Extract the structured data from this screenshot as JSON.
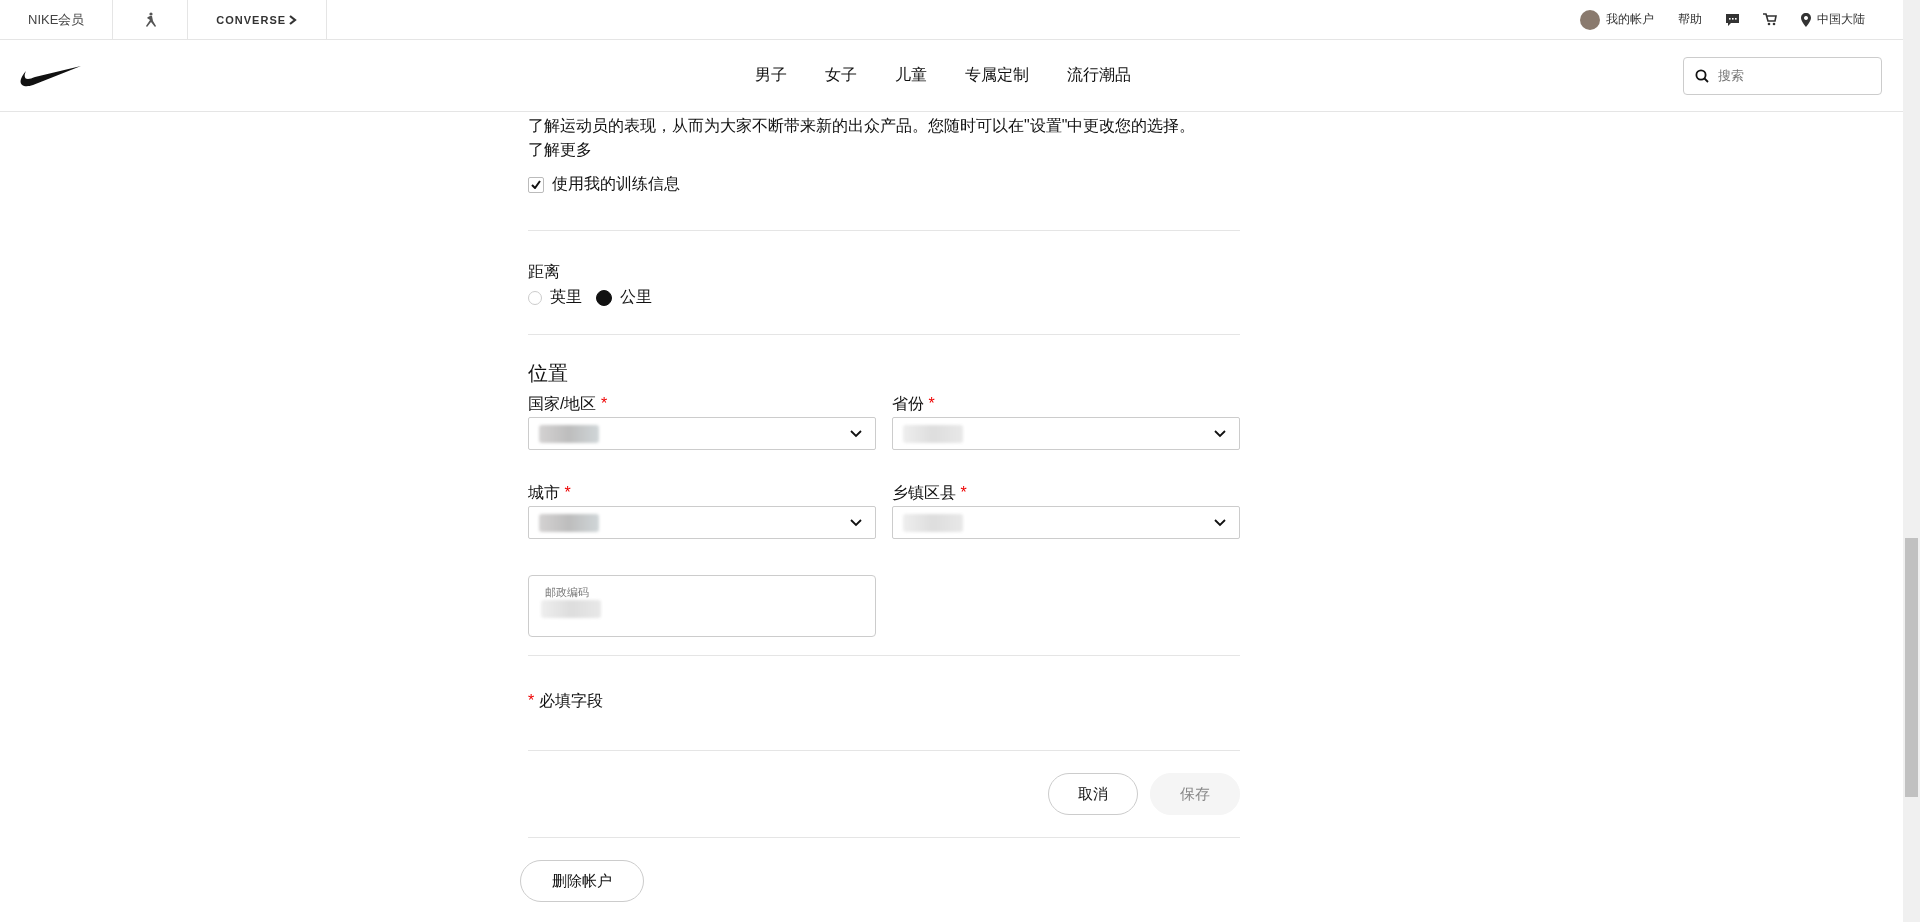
{
  "top_bar": {
    "left": [
      {
        "kind": "text",
        "label": "NIKE会员"
      },
      {
        "kind": "jordan"
      },
      {
        "kind": "converse",
        "label": "CONVERSE"
      }
    ],
    "right": [
      {
        "kind": "account",
        "label": "我的帐户"
      },
      {
        "kind": "text",
        "label": "帮助"
      },
      {
        "kind": "chat"
      },
      {
        "kind": "cart"
      },
      {
        "kind": "region",
        "label": "中国大陆"
      }
    ]
  },
  "nav": {
    "items": [
      "男子",
      "女子",
      "儿童",
      "专属定制",
      "流行潮品"
    ],
    "search": {
      "placeholder": "搜索"
    }
  },
  "intro": {
    "text": "了解运动员的表现，从而为大家不断带来新的出众产品。您随时可以在\"设置\"中更改您的选择。",
    "link": "了解更多"
  },
  "training_checkbox": {
    "label": "使用我的训练信息",
    "checked": true
  },
  "distance": {
    "title": "距离",
    "options": [
      {
        "label": "英里",
        "selected": false
      },
      {
        "label": "公里",
        "selected": true
      }
    ]
  },
  "location": {
    "title": "位置",
    "fields": [
      {
        "kind": "select",
        "label": "国家/地区",
        "required_mark": "*"
      },
      {
        "kind": "select",
        "label": "省份",
        "required_mark": "*"
      },
      {
        "kind": "select",
        "label": "城市",
        "required_mark": "*"
      },
      {
        "kind": "select",
        "label": "乡镇区县",
        "required_mark": "*"
      },
      {
        "kind": "text",
        "label": "邮政编码"
      }
    ]
  },
  "required_note": {
    "mark": "*",
    "text": "必填字段"
  },
  "buttons": [
    {
      "label": "取消",
      "disabled": false
    },
    {
      "label": "保存",
      "disabled": true
    }
  ],
  "delete_button": {
    "label": "删除帐户"
  }
}
